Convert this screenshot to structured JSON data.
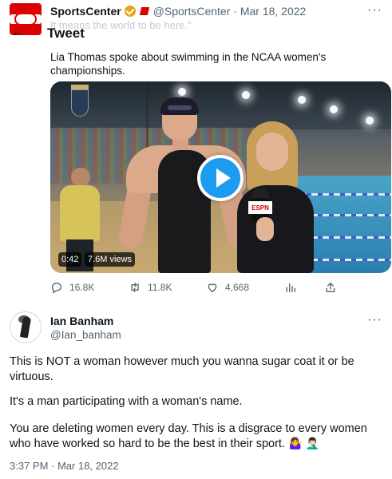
{
  "parent_tweet": {
    "display_name": "SportsCenter",
    "handle": "@SportsCenter",
    "date": "Mar 18, 2022",
    "handle_date": "@SportsCenter · Mar 18, 2022",
    "more_icon": "ellipsis-icon",
    "faded_line": "It means the world to be here.\"",
    "caption": "Lia Thomas spoke about swimming in the NCAA women's championships.",
    "video": {
      "duration": "0:42",
      "views": "7.6M views",
      "play_icon": "play-icon",
      "mic_logo": "ESPN"
    },
    "actions": {
      "replies": "16.8K",
      "retweets": "11.8K",
      "likes": "4,668",
      "analytics_icon": "bar-chart-icon",
      "share_icon": "share-icon"
    }
  },
  "header": {
    "back_icon": "back-arrow-icon",
    "title": "Tweet"
  },
  "reply_tweet": {
    "display_name": "Ian Banham",
    "handle": "@Ian_banham",
    "more_icon": "ellipsis-icon",
    "paragraph_1": "This is NOT a woman however much you wanna sugar coat it or be virtuous.",
    "paragraph_2": "It's a man participating with a woman's name.",
    "paragraph_3": "You are deleting women every day. This is a disgrace to every women who have worked so hard to be the best in their sport.",
    "emoji_1": "🤷‍♀️",
    "emoji_2": "🤦🏻‍♂️",
    "timestamp": "3:37 PM · Mar 18, 2022"
  },
  "colors": {
    "link_blue": "#1d9bf0",
    "secondary_text": "#536471",
    "primary_text": "#0f1419",
    "espn_red": "#dd0000",
    "verified_gold": "#e8a517"
  }
}
